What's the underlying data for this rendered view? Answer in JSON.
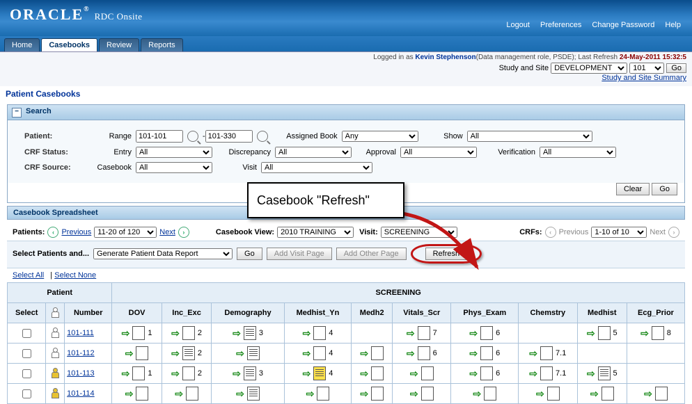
{
  "banner": {
    "logo": "ORACLE",
    "subtitle": "RDC Onsite",
    "links": [
      "Logout",
      "Preferences",
      "Change Password",
      "Help"
    ]
  },
  "tabs": [
    "Home",
    "Casebooks",
    "Review",
    "Reports"
  ],
  "active_tab": 1,
  "userbar": {
    "prefix": "Logged in ",
    "as": "as ",
    "user": "Kevin Stephenson",
    "role": "(Data management role, PSDE); Last Refresh ",
    "date": "24-May-2011 15:32:5"
  },
  "sitebar": {
    "label": "Study and Site",
    "study": "DEVELOPMENT",
    "site": "101",
    "go": "Go",
    "summary": "Study and Site Summary"
  },
  "section_title": "Patient Casebooks",
  "search": {
    "hd": "Search",
    "patient_lbl": "Patient:",
    "range_lbl": "Range",
    "range_from": "101-101",
    "range_to": "101-330",
    "assigned_lbl": "Assigned Book",
    "assigned": "Any",
    "show_lbl": "Show",
    "show": "All",
    "crfstatus_lbl": "CRF Status:",
    "entry_lbl": "Entry",
    "entry": "All",
    "disc_lbl": "Discrepancy",
    "disc": "All",
    "appr_lbl": "Approval",
    "appr": "All",
    "ver_lbl": "Verification",
    "ver": "All",
    "crfsource_lbl": "CRF Source:",
    "cb_lbl": "Casebook",
    "cb": "All",
    "visit_lbl": "Visit",
    "visit": "All",
    "clear": "Clear",
    "go": "Go"
  },
  "callout": "Casebook \"Refresh\"",
  "spreadsheet": {
    "hd": "Casebook Spreadsheet",
    "patients_lbl": "Patients:",
    "prev": "Previous",
    "page": "11-20 of 120",
    "next": "Next",
    "cbview_lbl": "Casebook View:",
    "cbview": "2010 TRAINING",
    "visit_lbl": "Visit:",
    "visit": "SCREENING",
    "crfs_lbl": "CRFs:",
    "crfs_page": "1-10 of 10",
    "select_lbl": "Select Patients and...",
    "action": "Generate Patient Data Report",
    "go": "Go",
    "addvisit": "Add Visit Page",
    "addother": "Add Other Page",
    "refresh": "Refresh",
    "selall": "Select All",
    "selnone": "Select None",
    "group_patient": "Patient",
    "group_visit": "SCREENING",
    "cols": [
      "Select",
      "",
      "Number",
      "DOV",
      "Inc_Exc",
      "Demography",
      "Medhist_Yn",
      "Medh2",
      "Vitals_Scr",
      "Phys_Exam",
      "Chemstry",
      "Medhist",
      "Ecg_Prior"
    ],
    "rows": [
      {
        "num": "101-111",
        "gold": false,
        "cells": [
          {
            "t": "arrow",
            "n": "1"
          },
          {
            "t": "arrow",
            "n": "2"
          },
          {
            "t": "lines",
            "n": "3"
          },
          {
            "t": "arrow",
            "n": "4"
          },
          {
            "t": "empty"
          },
          {
            "t": "arrow",
            "n": "7"
          },
          {
            "t": "arrow",
            "n": "6"
          },
          {
            "t": "empty"
          },
          {
            "t": "arrow",
            "n": "5"
          },
          {
            "t": "arrow",
            "n": "8"
          }
        ]
      },
      {
        "num": "101-112",
        "gold": false,
        "cells": [
          {
            "t": "arrow",
            "n": ""
          },
          {
            "t": "lines",
            "n": "2"
          },
          {
            "t": "lines",
            "n": ""
          },
          {
            "t": "blank",
            "n": "4"
          },
          {
            "t": "arrow",
            "n": ""
          },
          {
            "t": "arrow",
            "n": "6"
          },
          {
            "t": "blank",
            "n": "6"
          },
          {
            "t": "blank",
            "n": "7.1"
          },
          {
            "t": "empty"
          },
          {
            "t": "empty"
          }
        ]
      },
      {
        "num": "101-113",
        "gold": true,
        "cells": [
          {
            "t": "arrow",
            "n": "1"
          },
          {
            "t": "blank",
            "n": "2"
          },
          {
            "t": "lines",
            "n": "3"
          },
          {
            "t": "yellow",
            "n": "4"
          },
          {
            "t": "arrow",
            "n": ""
          },
          {
            "t": "arrow",
            "n": ""
          },
          {
            "t": "blank",
            "n": "6"
          },
          {
            "t": "blank",
            "n": "7.1"
          },
          {
            "t": "lines",
            "n": "5"
          },
          {
            "t": "empty"
          }
        ]
      },
      {
        "num": "101-114",
        "gold": true,
        "cells": [
          {
            "t": "arrow",
            "n": ""
          },
          {
            "t": "arrow",
            "n": ""
          },
          {
            "t": "lines",
            "n": ""
          },
          {
            "t": "arrow",
            "n": ""
          },
          {
            "t": "arrow",
            "n": ""
          },
          {
            "t": "arrow",
            "n": ""
          },
          {
            "t": "arrow",
            "n": ""
          },
          {
            "t": "arrow",
            "n": ""
          },
          {
            "t": "arrow",
            "n": ""
          },
          {
            "t": "arrow",
            "n": ""
          }
        ]
      }
    ]
  }
}
